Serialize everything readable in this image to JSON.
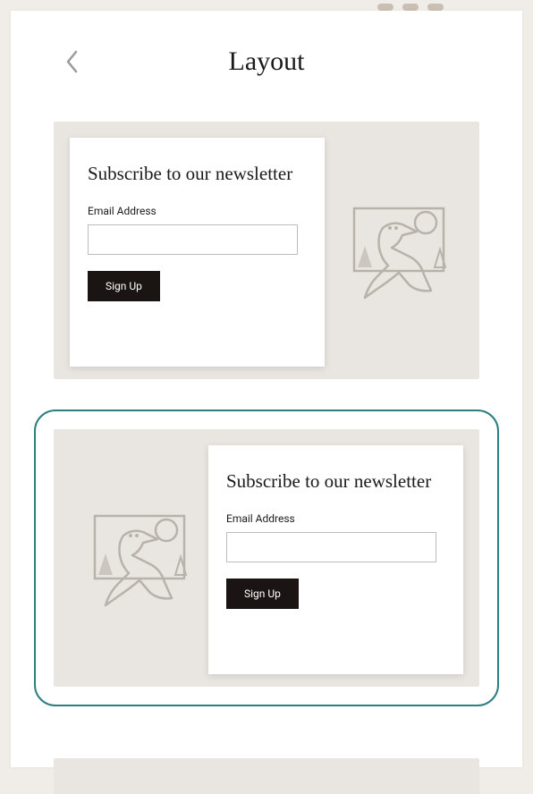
{
  "header": {
    "title": "Layout"
  },
  "layouts": [
    {
      "heading": "Subscribe to our newsletter",
      "field_label": "Email Address",
      "button_label": "Sign Up",
      "image_position": "right",
      "selected": false
    },
    {
      "heading": "Subscribe to our newsletter",
      "field_label": "Email Address",
      "button_label": "Sign Up",
      "image_position": "left",
      "selected": true
    }
  ],
  "icons": {
    "back": "chevron-left",
    "illustration": "bird-line-art"
  }
}
